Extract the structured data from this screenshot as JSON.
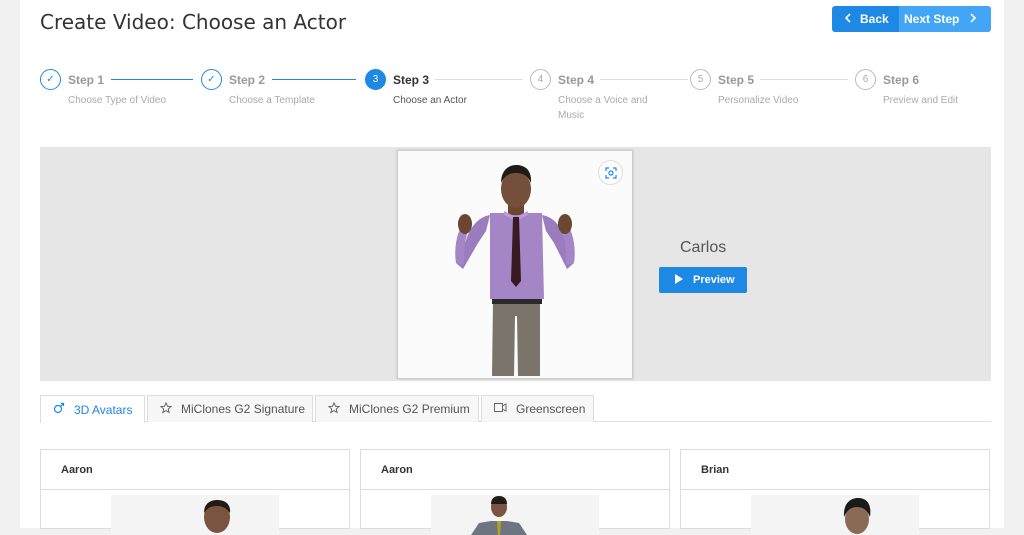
{
  "header": {
    "title": "Create Video: Choose an Actor",
    "back_label": "Back",
    "next_label": "Next Step"
  },
  "steps": [
    {
      "label": "Step 1",
      "desc": "Choose Type of Video",
      "marker": "✓",
      "state": "done"
    },
    {
      "label": "Step 2",
      "desc": "Choose a Template",
      "marker": "✓",
      "state": "done"
    },
    {
      "label": "Step 3",
      "desc": "Choose an Actor",
      "marker": "3",
      "state": "active"
    },
    {
      "label": "Step 4",
      "desc": "Choose a Voice and Music",
      "marker": "4",
      "state": "pending"
    },
    {
      "label": "Step 5",
      "desc": "Personalize Video",
      "marker": "5",
      "state": "pending"
    },
    {
      "label": "Step 6",
      "desc": "Preview and Edit",
      "marker": "6",
      "state": "pending"
    }
  ],
  "selected_actor": {
    "name": "Carlos",
    "preview_label": "Preview"
  },
  "tabs": [
    {
      "label": "3D Avatars",
      "icon": "avatar-icon",
      "active": true
    },
    {
      "label": "MiClones G2 Signature",
      "icon": "star-icon",
      "active": false
    },
    {
      "label": "MiClones G2 Premium",
      "icon": "star-icon",
      "active": false
    },
    {
      "label": "Greenscreen",
      "icon": "video-icon",
      "active": false
    }
  ],
  "avatars": [
    {
      "name": "Aaron"
    },
    {
      "name": "Aaron"
    },
    {
      "name": "Brian"
    }
  ],
  "colors": {
    "accent": "#1e88e5",
    "accent_light": "#42a5f5",
    "preview_bg": "#e6e6e6"
  }
}
